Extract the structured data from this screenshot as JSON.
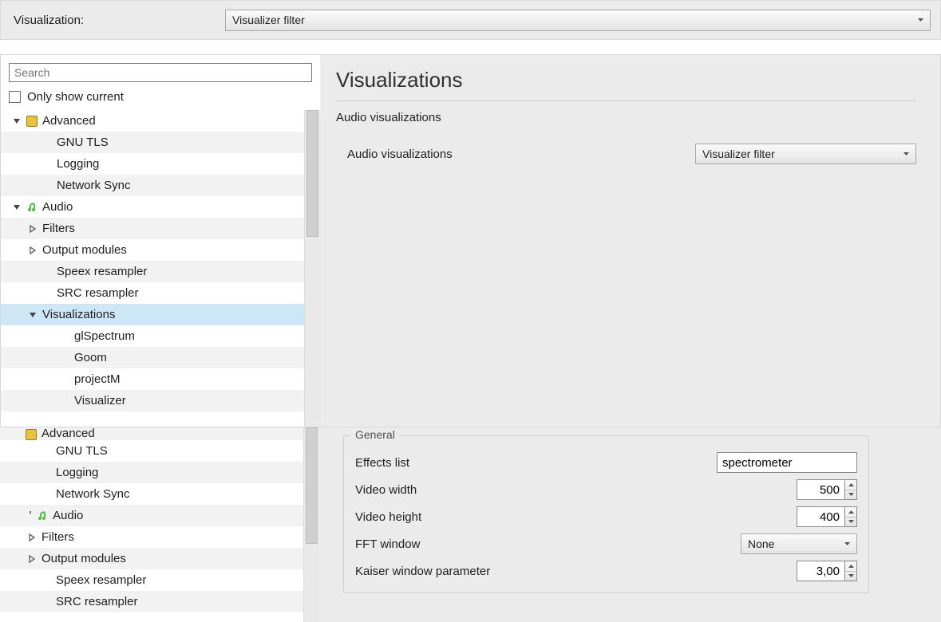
{
  "topbar": {
    "label": "Visualization:",
    "value": "Visualizer filter"
  },
  "search": {
    "placeholder": "Search"
  },
  "only_show_label": "Only show current",
  "tree_upper": [
    {
      "label": "Advanced",
      "chev": "down",
      "icon": "chip",
      "ind": "ind0"
    },
    {
      "label": "GNU TLS",
      "chev": "none",
      "icon": "",
      "ind": "ind1b"
    },
    {
      "label": "Logging",
      "chev": "none",
      "icon": "",
      "ind": "ind1b"
    },
    {
      "label": "Network Sync",
      "chev": "none",
      "icon": "",
      "ind": "ind1b"
    },
    {
      "label": "Audio",
      "chev": "down",
      "icon": "audio",
      "ind": "ind0"
    },
    {
      "label": "Filters",
      "chev": "right",
      "icon": "",
      "ind": "ind1"
    },
    {
      "label": "Output modules",
      "chev": "right",
      "icon": "",
      "ind": "ind1"
    },
    {
      "label": "Speex resampler",
      "chev": "none",
      "icon": "",
      "ind": "ind1b"
    },
    {
      "label": "SRC resampler",
      "chev": "none",
      "icon": "",
      "ind": "ind1b"
    },
    {
      "label": "Visualizations",
      "chev": "down",
      "icon": "",
      "ind": "ind1",
      "sel": true
    },
    {
      "label": "glSpectrum",
      "chev": "none",
      "icon": "",
      "ind": "ind2"
    },
    {
      "label": "Goom",
      "chev": "none",
      "icon": "",
      "ind": "ind2"
    },
    {
      "label": "projectM",
      "chev": "none",
      "icon": "",
      "ind": "ind2"
    },
    {
      "label": "Visualizer",
      "chev": "none",
      "icon": "",
      "ind": "ind2"
    }
  ],
  "panel_upper": {
    "title": "Visualizations",
    "section": "Audio visualizations",
    "field_label": "Audio visualizations",
    "combo_value": "Visualizer filter"
  },
  "tree_lower": [
    {
      "label": "Advanced",
      "chev": "none",
      "icon": "chip",
      "ind": "ind0t",
      "cut": true
    },
    {
      "label": "GNU TLS",
      "chev": "none",
      "icon": "",
      "ind": "ind1b"
    },
    {
      "label": "Logging",
      "chev": "none",
      "icon": "",
      "ind": "ind1b"
    },
    {
      "label": "Network Sync",
      "chev": "none",
      "icon": "",
      "ind": "ind1b"
    },
    {
      "label": "Audio",
      "chev": "none",
      "icon": "audio",
      "ind": "ind0t",
      "arrow": "'"
    },
    {
      "label": "Filters",
      "chev": "right",
      "icon": "",
      "ind": "ind1"
    },
    {
      "label": "Output modules",
      "chev": "right",
      "icon": "",
      "ind": "ind1"
    },
    {
      "label": "Speex resampler",
      "chev": "none",
      "icon": "",
      "ind": "ind1b"
    },
    {
      "label": "SRC resampler",
      "chev": "none",
      "icon": "",
      "ind": "ind1b"
    }
  ],
  "group": {
    "legend": "General",
    "effects_label": "Effects list",
    "effects_value": "spectrometer",
    "width_label": "Video width",
    "width_value": "500",
    "height_label": "Video height",
    "height_value": "400",
    "fft_label": "FFT window",
    "fft_value": "None",
    "kaiser_label": "Kaiser window parameter",
    "kaiser_value": "3,00"
  }
}
